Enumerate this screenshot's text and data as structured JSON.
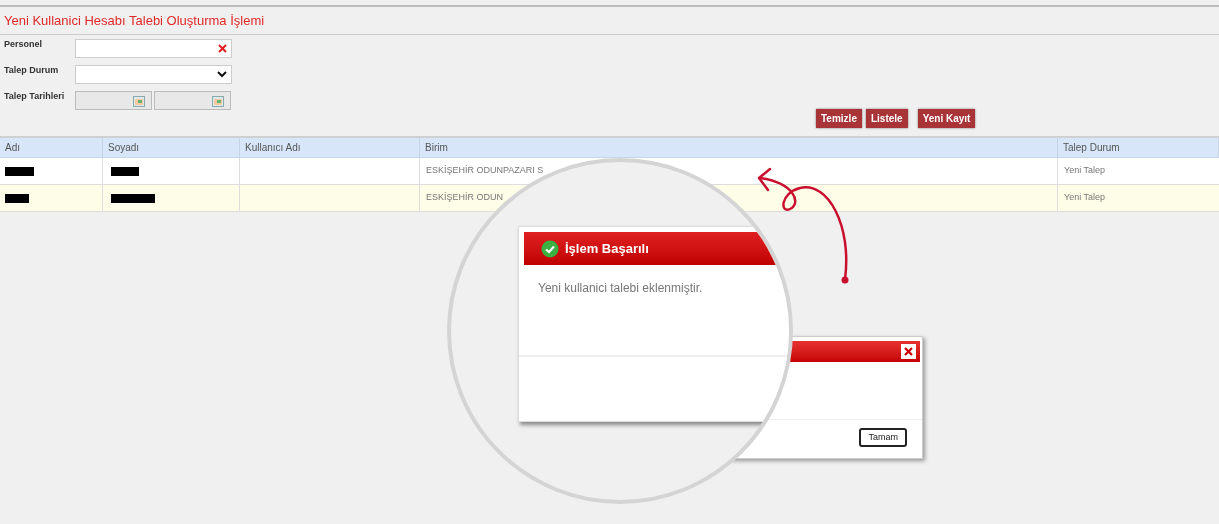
{
  "page_title": "Yeni Kullanici Hesabı Talebi Oluşturma İşlemi",
  "filters": [
    {
      "label": "Personel",
      "kind": "text_clear"
    },
    {
      "label": "Talep Durum",
      "kind": "select"
    },
    {
      "label": "Talep Tarihleri",
      "kind": "date_range"
    }
  ],
  "buttons": [
    "Temizle",
    "Listele",
    "Yeni Kayıt"
  ],
  "table": {
    "columns": [
      "Adı",
      "Soyadı",
      "Kullanıcı Adı",
      "Birim",
      "Talep Durum"
    ],
    "rows": [
      {
        "birim": "ESKİŞEHİR ODUNPAZARI S",
        "talep_durum": "Yeni Talep"
      },
      {
        "birim": "ESKİŞEHİR ODUN",
        "talep_durum": "Yeni Talep"
      }
    ]
  },
  "dialog": {
    "button": "Tamam"
  },
  "magnified_dialog": {
    "title": "İşlem Başarılı",
    "message": "Yeni kullanici talebi eklenmiştir."
  }
}
